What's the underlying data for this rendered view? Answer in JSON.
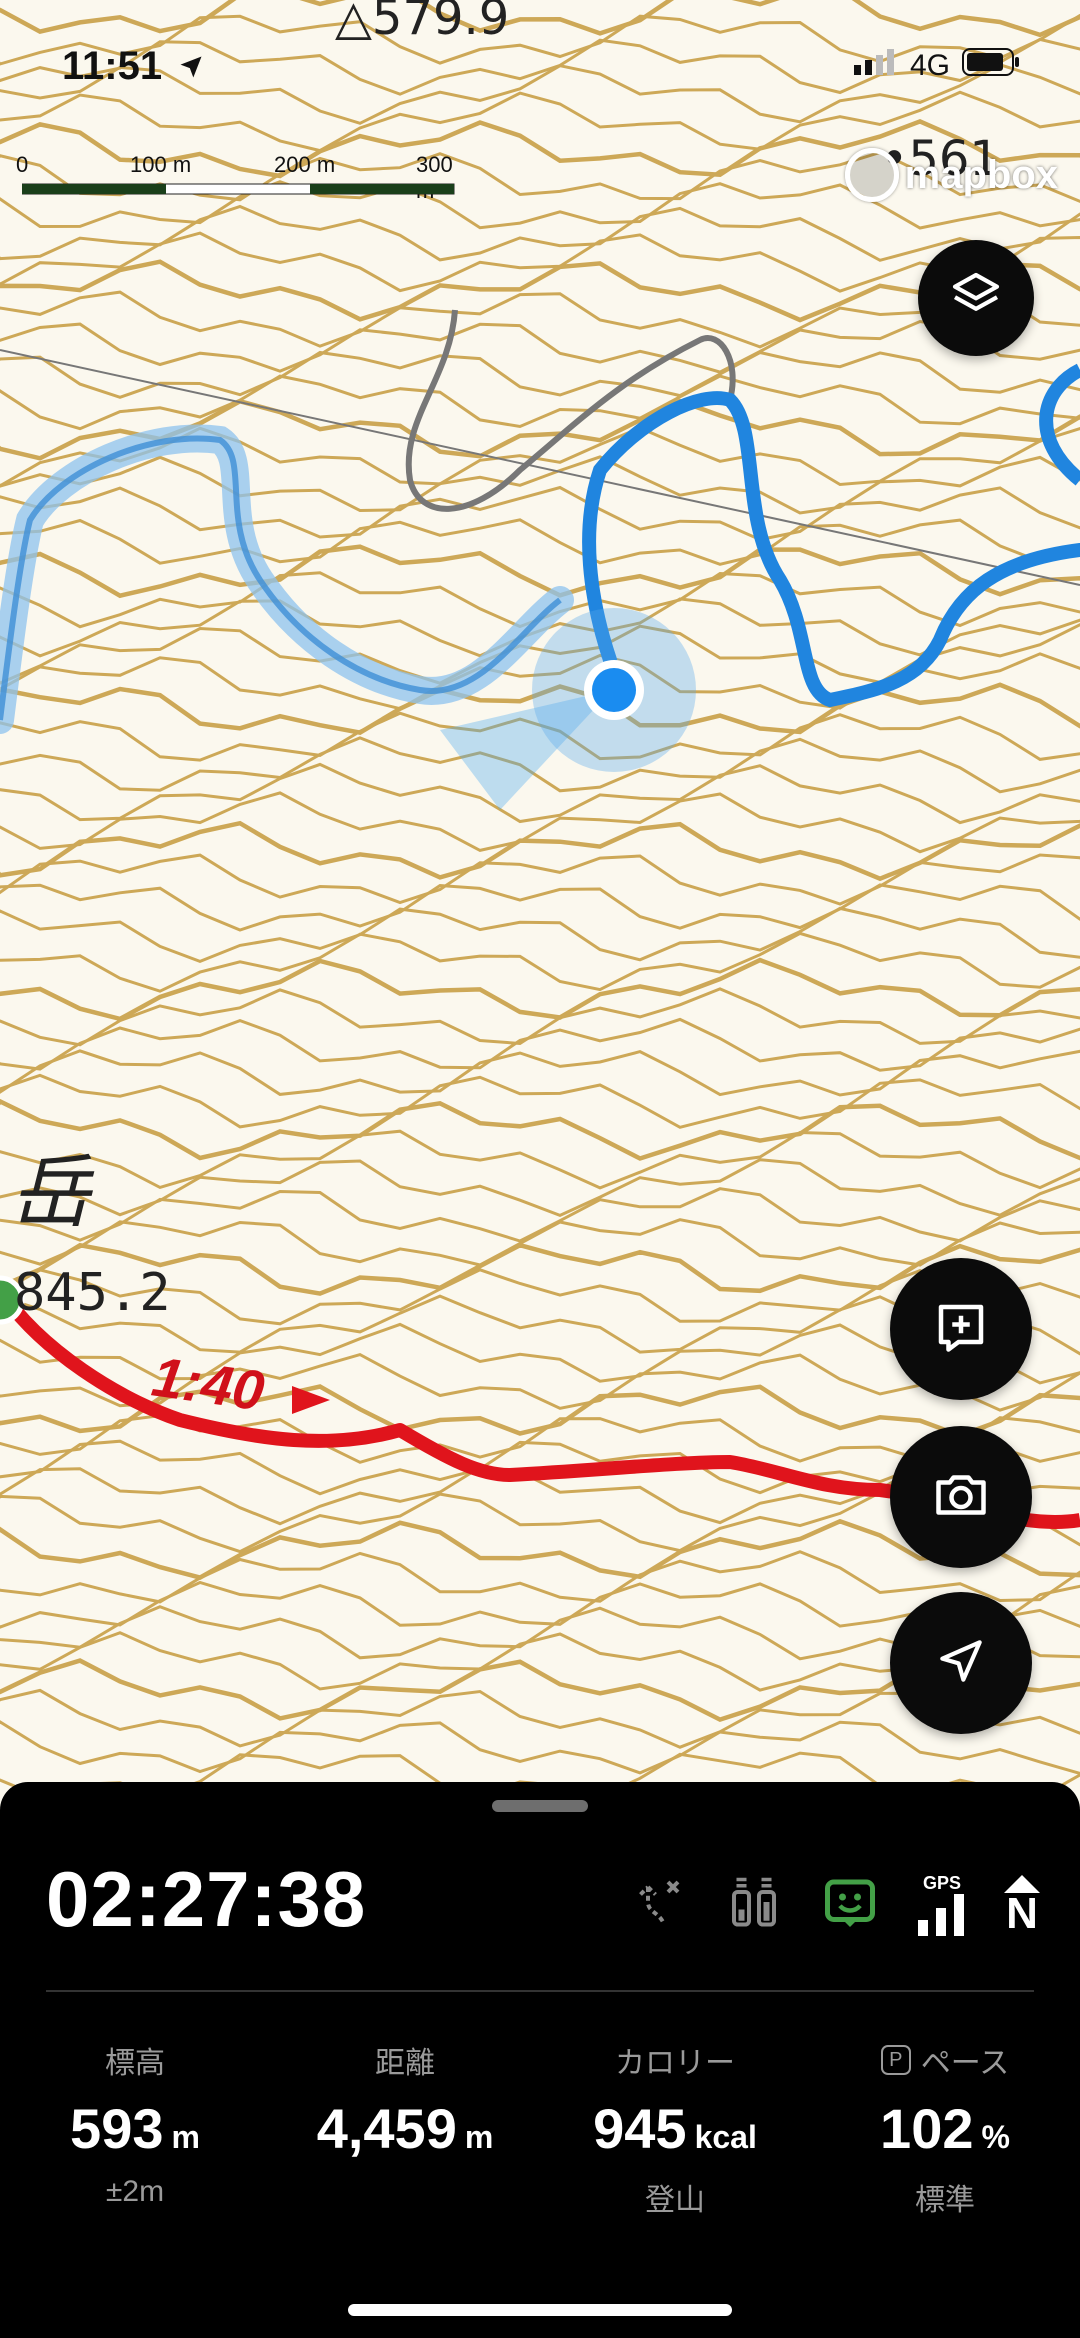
{
  "status_bar": {
    "time": "11:51",
    "network": "4G"
  },
  "map": {
    "peak_top": "△579.9",
    "peak_top_right": "•561",
    "peak_left": "845.2",
    "mountain_char": "岳",
    "route_time": "1:40",
    "attribution": "mapbox",
    "scale_labels": [
      "0",
      "100 m",
      "200 m",
      "300 m"
    ]
  },
  "panel": {
    "timer": "02:27:38",
    "stats": [
      {
        "label": "標高",
        "value": "593",
        "unit": "m",
        "sub": "±2m"
      },
      {
        "label": "距離",
        "value": "4,459",
        "unit": "m",
        "sub": ""
      },
      {
        "label": "カロリー",
        "value": "945",
        "unit": "kcal",
        "sub": "登山"
      },
      {
        "label": "ペース",
        "badge": "P",
        "value": "102",
        "unit": "%",
        "sub": "標準"
      }
    ],
    "gps_label": "GPS",
    "north_label": "N"
  },
  "colors": {
    "contour": "#c79a3c",
    "track": "#1e88e5",
    "route": "#e0141c",
    "accent_green": "#43a047"
  },
  "icons": [
    "navigation-arrow-icon",
    "layers-icon",
    "add-memo-icon",
    "camera-icon",
    "locate-icon",
    "off-route-icon",
    "battery-icon",
    "face-icon",
    "gps-signal-icon",
    "north-icon"
  ]
}
